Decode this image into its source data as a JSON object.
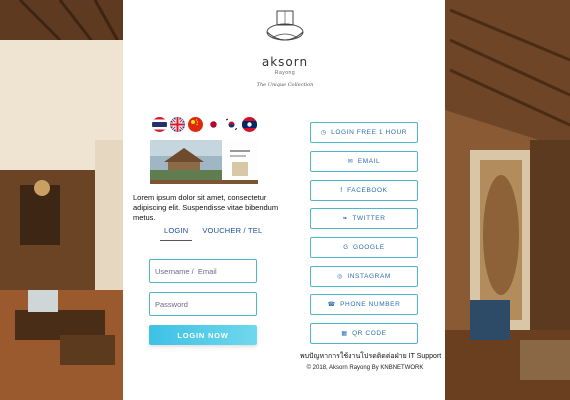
{
  "logo": {
    "name": "aksorn",
    "subtitle": "Rayong",
    "collection": "The Unique Collection"
  },
  "flags": [
    {
      "name": "thai-flag-icon"
    },
    {
      "name": "uk-flag-icon"
    },
    {
      "name": "china-flag-icon"
    },
    {
      "name": "japan-flag-icon"
    },
    {
      "name": "korea-flag-icon"
    },
    {
      "name": "laos-flag-icon"
    }
  ],
  "description": "Lorem ipsum dolor sit amet, consectetur adipiscing elit. Suspendisse vitae bibendum metus.",
  "tabs": {
    "login": "LOGIN",
    "voucher": "VOUCHER / TEL"
  },
  "form": {
    "username_placeholder": "Username /  Email",
    "password_placeholder": "Password",
    "login_button": "LOGIN NOW"
  },
  "social": [
    {
      "icon": "◷",
      "label": "LOGIN FREE 1 HOUR"
    },
    {
      "icon": "✉",
      "label": "EMAIL"
    },
    {
      "icon": "f",
      "label": "FACEBOOK"
    },
    {
      "icon": "❧",
      "label": "TWITTER"
    },
    {
      "icon": "G",
      "label": "GOOGLE"
    },
    {
      "icon": "◎",
      "label": "INSTAGRAM"
    },
    {
      "icon": "☎",
      "label": "PHONE NUMBER"
    },
    {
      "icon": "▦",
      "label": "QR CODE"
    }
  ],
  "support_text": "พบปัญหาการใช้งานโปรดติดต่อฝ่าย IT Support",
  "copyright": "© 2018, Aksorn Rayong By KNBNETWORK",
  "colors": {
    "accent": "#4fb7c9",
    "button_gradient_start": "#3ec1e6",
    "link": "#2a6fb0"
  }
}
